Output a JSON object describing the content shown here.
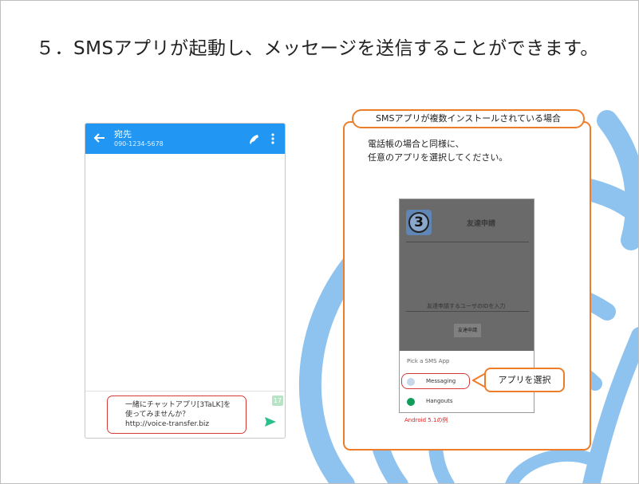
{
  "slide": {
    "title": "５．SMSアプリが起動し、メッセージを送信することができます。"
  },
  "phone": {
    "contact_name": "宛先",
    "contact_number": "090-1234-5678",
    "message_lines": [
      "一緒にチャットアプリ[3TaLK]を",
      "使ってみませんか？",
      "http://voice-transfer.biz"
    ],
    "char_counter": "17",
    "icons": {
      "back": "arrow-left-icon",
      "call": "phone-icon",
      "more": "more-vert-icon",
      "send": "send-icon"
    }
  },
  "panel": {
    "tag": "SMSアプリが複数インストールされている場合",
    "desc_line1": "電話帳の場合と同様に、",
    "desc_line2": "任意のアプリを選択してください。",
    "screenshot": {
      "logo_text": "3",
      "title": "友達申請",
      "input_hint": "友達申請するユーザのIDを入力",
      "button_label": "友達申請",
      "picker_title": "Pick a SMS App",
      "apps": [
        {
          "label": "Messaging",
          "icon": "messaging-icon",
          "color": "#c5d7e8"
        },
        {
          "label": "Hangouts",
          "icon": "hangouts-icon",
          "color": "#0f9d58"
        }
      ]
    },
    "android_note": "Android 5.1の例",
    "callout": "アプリを選択"
  },
  "colors": {
    "accent_orange": "#ee7d2a",
    "phone_bar": "#2196f3",
    "highlight_red": "#d83a3a",
    "swirl_blue": "#8ec3f0"
  }
}
